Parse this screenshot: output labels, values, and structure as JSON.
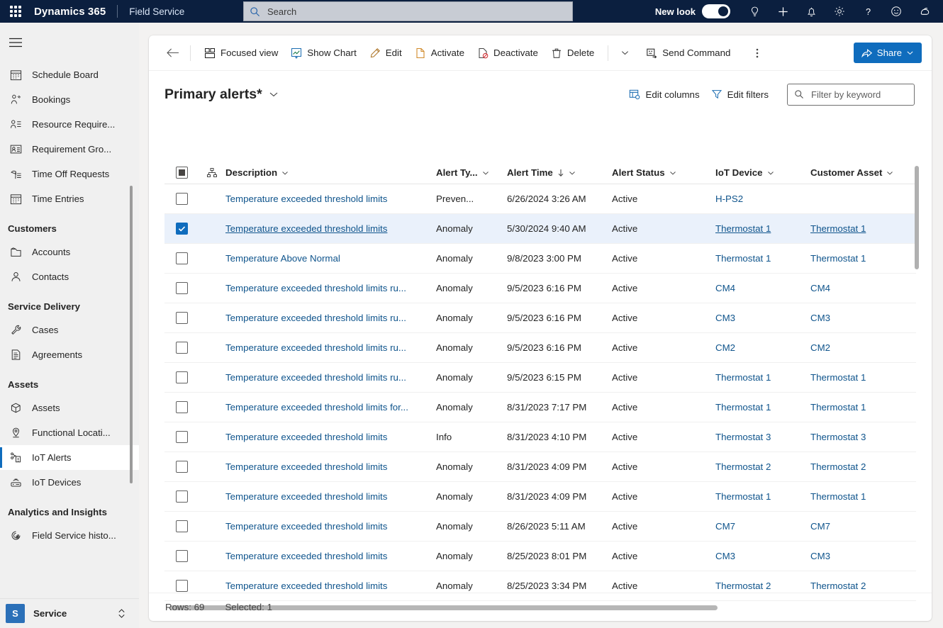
{
  "topbar": {
    "waffle_icon": "app-launcher-icon",
    "brand": "Dynamics 365",
    "app_name": "Field Service",
    "search": {
      "placeholder": "Search",
      "value": "",
      "icon": "search-icon"
    },
    "new_look_label": "New look",
    "new_look_on": true,
    "icons": [
      "lightbulb-icon",
      "plus-icon",
      "bell-icon",
      "gear-icon",
      "question-icon",
      "smiley-icon",
      "copilot-icon"
    ]
  },
  "sidebar": {
    "hamburger_icon": "hamburger-icon",
    "entries": [
      {
        "kind": "item",
        "label": "Schedule Board",
        "icon": "calendar-icon",
        "active": false
      },
      {
        "kind": "item",
        "label": "Bookings",
        "icon": "person-run-icon",
        "active": false
      },
      {
        "kind": "item",
        "label": "Resource Require...",
        "icon": "person-list-icon",
        "active": false
      },
      {
        "kind": "item",
        "label": "Requirement Gro...",
        "icon": "person-card-icon",
        "active": false
      },
      {
        "kind": "item",
        "label": "Time Off Requests",
        "icon": "time-off-icon",
        "active": false
      },
      {
        "kind": "item",
        "label": "Time Entries",
        "icon": "calendar-icon",
        "active": false
      },
      {
        "kind": "group",
        "label": "Customers"
      },
      {
        "kind": "item",
        "label": "Accounts",
        "icon": "accounts-icon",
        "active": false
      },
      {
        "kind": "item",
        "label": "Contacts",
        "icon": "contact-icon",
        "active": false
      },
      {
        "kind": "group",
        "label": "Service Delivery"
      },
      {
        "kind": "item",
        "label": "Cases",
        "icon": "wrench-icon",
        "active": false
      },
      {
        "kind": "item",
        "label": "Agreements",
        "icon": "document-icon",
        "active": false
      },
      {
        "kind": "group",
        "label": "Assets"
      },
      {
        "kind": "item",
        "label": "Assets",
        "icon": "box-icon",
        "active": false
      },
      {
        "kind": "item",
        "label": "Functional Locati...",
        "icon": "location-pin-icon",
        "active": false
      },
      {
        "kind": "item",
        "label": "IoT Alerts",
        "icon": "iot-alert-icon",
        "active": true
      },
      {
        "kind": "item",
        "label": "IoT Devices",
        "icon": "iot-device-icon",
        "active": false
      },
      {
        "kind": "group",
        "label": "Analytics and Insights"
      },
      {
        "kind": "item",
        "label": "Field Service histo...",
        "icon": "analytics-icon",
        "active": false
      }
    ],
    "area_switcher": {
      "badge": "S",
      "label": "Service",
      "chevron_icon": "updown-chevron-icon"
    }
  },
  "commandbar": {
    "back_icon": "back-arrow-icon",
    "buttons": [
      {
        "label": "Focused view",
        "icon": "focused-view-icon"
      },
      {
        "label": "Show Chart",
        "icon": "show-chart-icon"
      },
      {
        "label": "Edit",
        "icon": "pencil-icon"
      },
      {
        "label": "Activate",
        "icon": "activate-icon"
      },
      {
        "label": "Deactivate",
        "icon": "deactivate-icon"
      },
      {
        "label": "Delete",
        "icon": "trash-icon"
      }
    ],
    "chevron_icon": "chevron-down-icon",
    "send_command": {
      "label": "Send Command",
      "icon": "send-command-icon"
    },
    "overflow_icon": "more-vertical-icon",
    "share": {
      "label": "Share",
      "icon": "share-icon",
      "chevron_icon": "chevron-down-icon",
      "color": "#0f6cbd"
    }
  },
  "view": {
    "title": "Primary alerts*",
    "title_chevron_icon": "chevron-down-icon",
    "edit_columns": {
      "label": "Edit columns",
      "icon": "edit-columns-icon"
    },
    "edit_filters": {
      "label": "Edit filters",
      "icon": "filter-icon"
    },
    "keyword_filter": {
      "placeholder": "Filter by keyword",
      "value": "",
      "icon": "search-icon"
    }
  },
  "grid": {
    "select_all_icon": "select-all-checkbox-icon",
    "hierarchy_icon": "hierarchy-icon",
    "columns": [
      {
        "key": "description",
        "label": "Description",
        "sorted": false
      },
      {
        "key": "alert_type",
        "label": "Alert Ty...",
        "sorted": false
      },
      {
        "key": "alert_time",
        "label": "Alert Time",
        "sorted": true,
        "sort_dir": "desc",
        "sort_icon": "sort-down-icon"
      },
      {
        "key": "alert_status",
        "label": "Alert Status",
        "sorted": false
      },
      {
        "key": "iot_device",
        "label": "IoT Device",
        "sorted": false
      },
      {
        "key": "customer_asset",
        "label": "Customer Asset",
        "sorted": false
      }
    ],
    "rows": [
      {
        "selected": false,
        "description": "Temperature exceeded threshold limits",
        "alert_type": "Preven...",
        "alert_time": "6/26/2024 3:26 AM",
        "alert_status": "Active",
        "iot_device": "H-PS2",
        "customer_asset": ""
      },
      {
        "selected": true,
        "description": "Temperature exceeded threshold limits",
        "alert_type": "Anomaly",
        "alert_time": "5/30/2024 9:40 AM",
        "alert_status": "Active",
        "iot_device": "Thermostat 1",
        "customer_asset": "Thermostat 1"
      },
      {
        "selected": false,
        "description": "Temperature Above Normal",
        "alert_type": "Anomaly",
        "alert_time": "9/8/2023 3:00 PM",
        "alert_status": "Active",
        "iot_device": "Thermostat 1",
        "customer_asset": "Thermostat 1"
      },
      {
        "selected": false,
        "description": "Temperature exceeded threshold limits ru...",
        "alert_type": "Anomaly",
        "alert_time": "9/5/2023 6:16 PM",
        "alert_status": "Active",
        "iot_device": "CM4",
        "customer_asset": "CM4"
      },
      {
        "selected": false,
        "description": "Temperature exceeded threshold limits ru...",
        "alert_type": "Anomaly",
        "alert_time": "9/5/2023 6:16 PM",
        "alert_status": "Active",
        "iot_device": "CM3",
        "customer_asset": "CM3"
      },
      {
        "selected": false,
        "description": "Temperature exceeded threshold limits ru...",
        "alert_type": "Anomaly",
        "alert_time": "9/5/2023 6:16 PM",
        "alert_status": "Active",
        "iot_device": "CM2",
        "customer_asset": "CM2"
      },
      {
        "selected": false,
        "description": "Temperature exceeded threshold limits ru...",
        "alert_type": "Anomaly",
        "alert_time": "9/5/2023 6:15 PM",
        "alert_status": "Active",
        "iot_device": "Thermostat 1",
        "customer_asset": "Thermostat 1"
      },
      {
        "selected": false,
        "description": "Temperature exceeded threshold limits for...",
        "alert_type": "Anomaly",
        "alert_time": "8/31/2023 7:17 PM",
        "alert_status": "Active",
        "iot_device": "Thermostat 1",
        "customer_asset": "Thermostat 1"
      },
      {
        "selected": false,
        "description": "Temperature exceeded threshold limits",
        "alert_type": "Info",
        "alert_time": "8/31/2023 4:10 PM",
        "alert_status": "Active",
        "iot_device": "Thermostat 3",
        "customer_asset": "Thermostat 3"
      },
      {
        "selected": false,
        "description": "Temperature exceeded threshold limits",
        "alert_type": "Anomaly",
        "alert_time": "8/31/2023 4:09 PM",
        "alert_status": "Active",
        "iot_device": "Thermostat 2",
        "customer_asset": "Thermostat 2"
      },
      {
        "selected": false,
        "description": "Temperature exceeded threshold limits",
        "alert_type": "Anomaly",
        "alert_time": "8/31/2023 4:09 PM",
        "alert_status": "Active",
        "iot_device": "Thermostat 1",
        "customer_asset": "Thermostat 1"
      },
      {
        "selected": false,
        "description": "Temperature exceeded threshold limits",
        "alert_type": "Anomaly",
        "alert_time": "8/26/2023 5:11 AM",
        "alert_status": "Active",
        "iot_device": "CM7",
        "customer_asset": "CM7"
      },
      {
        "selected": false,
        "description": "Temperature exceeded threshold limits",
        "alert_type": "Anomaly",
        "alert_time": "8/25/2023 8:01 PM",
        "alert_status": "Active",
        "iot_device": "CM3",
        "customer_asset": "CM3"
      },
      {
        "selected": false,
        "description": "Temperature exceeded threshold limits",
        "alert_type": "Anomaly",
        "alert_time": "8/25/2023 3:34 PM",
        "alert_status": "Active",
        "iot_device": "Thermostat 2",
        "customer_asset": "Thermostat 2"
      }
    ]
  },
  "footer": {
    "rows_label": "Rows: 69",
    "selected_label": "Selected: 1"
  },
  "colors": {
    "header_bg": "#0b1f3f",
    "accent": "#0f6cbd",
    "link": "#0f548c",
    "selected_row": "#eaf1fb"
  }
}
